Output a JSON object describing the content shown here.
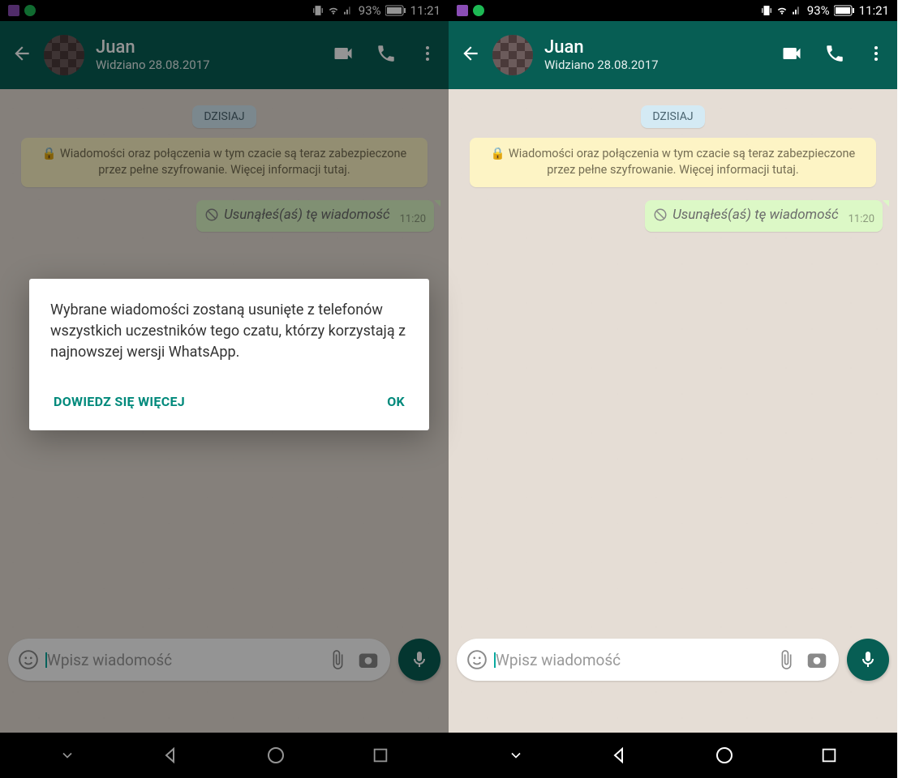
{
  "status": {
    "battery_pct": "93%",
    "time": "11:21"
  },
  "header": {
    "name": "Juan",
    "last_seen": "Widziano 28.08.2017"
  },
  "chat": {
    "date_label": "DZISIAJ",
    "encryption": "Wiadomości oraz połączenia w tym czacie są teraz zabezpieczone przez pełne szyfrowanie. Więcej informacji tutaj.",
    "deleted_msg": "Usunąłeś(aś) tę wiadomość",
    "msg_time": "11:20"
  },
  "input": {
    "placeholder": "Wpisz wiadomość"
  },
  "dialog": {
    "body": "Wybrane wiadomości zostaną usunięte z telefonów wszystkich uczestników tego czatu, którzy korzystają z najnowszej wersji WhatsApp.",
    "learn_more": "DOWIEDZ SIĘ WIĘCEJ",
    "ok": "OK"
  }
}
